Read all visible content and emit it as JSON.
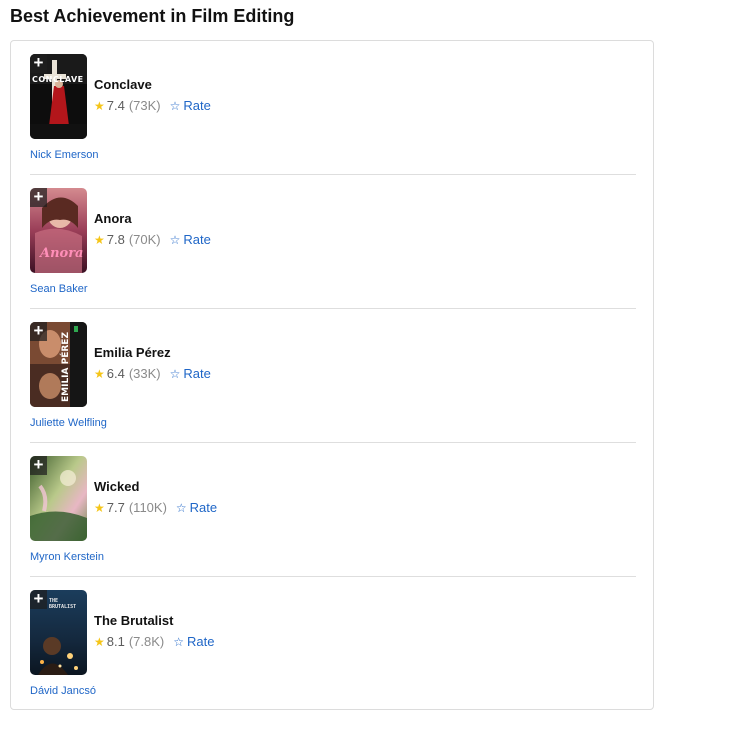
{
  "category": {
    "title": "Best Achievement in Film Editing"
  },
  "nominees": [
    {
      "title": "Conclave",
      "rating": "7.4",
      "votes": "(73K)",
      "rate_label": "Rate",
      "nominee": "Nick Emerson",
      "poster_text": "CONCLAVE"
    },
    {
      "title": "Anora",
      "rating": "7.8",
      "votes": "(70K)",
      "rate_label": "Rate",
      "nominee": "Sean Baker",
      "poster_text": "Anora"
    },
    {
      "title": "Emilia Pérez",
      "rating": "6.4",
      "votes": "(33K)",
      "rate_label": "Rate",
      "nominee": "Juliette Welfling",
      "poster_text": "EMILIA PÉREZ"
    },
    {
      "title": "Wicked",
      "rating": "7.7",
      "votes": "(110K)",
      "rate_label": "Rate",
      "nominee": "Myron Kerstein",
      "poster_text": ""
    },
    {
      "title": "The Brutalist",
      "rating": "8.1",
      "votes": "(7.8K)",
      "rate_label": "Rate",
      "nominee": "Dávid Jancsó",
      "poster_text": "THE BRUTALIST"
    }
  ],
  "icons": {
    "add": "plus-icon",
    "rating": "star-filled-icon",
    "rate": "star-outline-icon"
  },
  "colors": {
    "accent_star": "#f5c518",
    "link": "#1f66c7",
    "text": "#121212",
    "muted": "#8a8a8a"
  }
}
